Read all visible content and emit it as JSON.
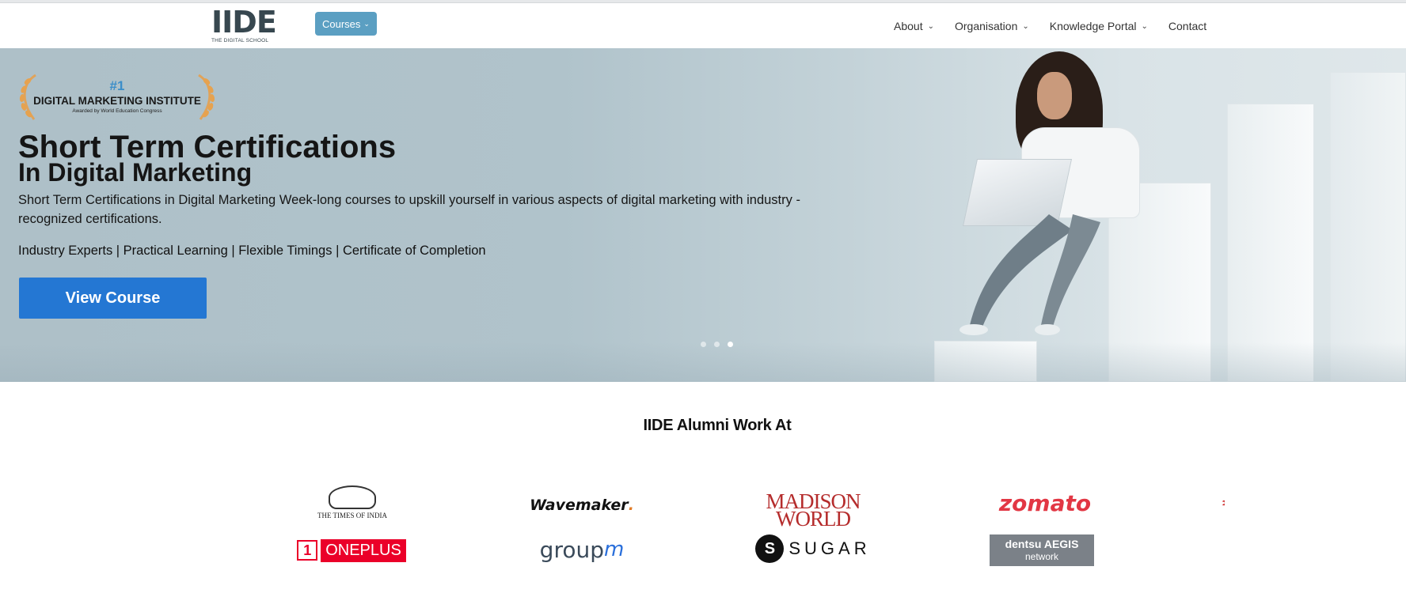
{
  "header": {
    "logo_text": "IIDE",
    "logo_subtitle": "THE DIGITAL SCHOOL",
    "courses_label": "Courses",
    "nav": [
      {
        "label": "About",
        "has_dropdown": true
      },
      {
        "label": "Organisation",
        "has_dropdown": true
      },
      {
        "label": "Knowledge Portal",
        "has_dropdown": true
      },
      {
        "label": "Contact",
        "has_dropdown": false
      }
    ]
  },
  "hero": {
    "badge": {
      "rank": "#1",
      "title": "DIGITAL MARKETING INSTITUTE",
      "subtitle": "Awarded by World Education Congress"
    },
    "title_line1": "Short Term Certifications",
    "title_line2": "In Digital Marketing",
    "description": "Short Term Certifications in Digital Marketing Week-long courses to upskill yourself in various aspects of digital marketing with industry - recognized certifications.",
    "features": "Industry Experts | Practical Learning | Flexible Timings | Certificate of Completion",
    "cta_label": "View Course",
    "carousel": {
      "total_slides": 3,
      "active_slide": 3
    }
  },
  "alumni": {
    "title": "IIDE Alumni Work At",
    "logos": [
      {
        "name": "The Times of India",
        "text": "THE TIMES OF INDIA"
      },
      {
        "name": "Wavemaker",
        "text": "Wavemaker"
      },
      {
        "name": "Madison World",
        "text_line1": "MADISON",
        "text_line2": "WORLD"
      },
      {
        "name": "Zomato",
        "text": "zomato"
      },
      {
        "name": "OnePlus",
        "text": "ONEPLUS",
        "mark": "1"
      },
      {
        "name": "GroupM",
        "text": "group",
        "sup": "m"
      },
      {
        "name": "Sugar",
        "text": "SUGAR",
        "mark": "S"
      },
      {
        "name": "dentsu Aegis network",
        "text_line1": "dentsu AEGIS",
        "text_line2": "network"
      }
    ]
  },
  "colors": {
    "primary_button": "#2477d3",
    "courses_button": "#5b9fc2",
    "badge_accent": "#3b8ec9"
  }
}
